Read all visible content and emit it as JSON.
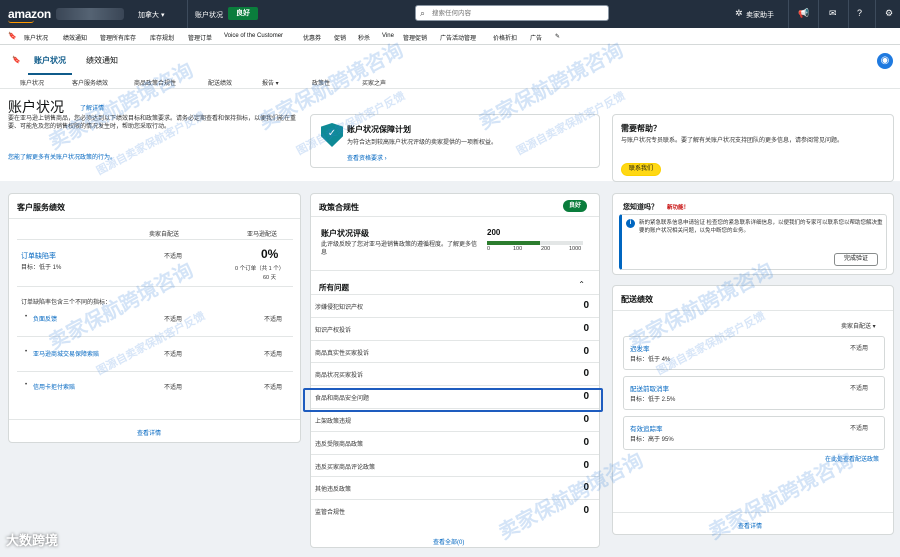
{
  "topbar": {
    "logo": "amazon",
    "region": "加拿大 ▾",
    "account_label": "账户状况",
    "account_badge": "良好",
    "search_placeholder": "搜索任何内容",
    "assistant": "卖家助手"
  },
  "nav": {
    "items": [
      "账户状况",
      "绩效通知",
      "管理所有库存",
      "库存规划",
      "管理订单",
      "Voice of the Customer",
      "优惠券",
      "促销",
      "秒杀",
      "Vine",
      "管理促销",
      "广告活动管理",
      "价格折扣",
      "广告"
    ]
  },
  "tabs": {
    "items": [
      "账户状况",
      "绩效通知"
    ]
  },
  "subnav": {
    "items": [
      "账户状况",
      "客户服务绩效",
      "商品政策合规性",
      "配送绩效",
      "报告 ▾",
      "政策性",
      "买家之声"
    ]
  },
  "header": {
    "title": "账户状况",
    "learn_more": "了解详情",
    "description": "要在亚马逊上销售商品，您必须达到以下绩效目标和政策要求。请务必定期查看和保持指标，以便我们能在重要、可能危及您的销售权限的情况发生时，帮助您采取行动。",
    "footer_link": "您能了解更多有关账户状况政策的行为。"
  },
  "protection": {
    "title": "账户状况保障计划",
    "description": "为符合达到较高账户状况评级的卖家提供的一项新权益。",
    "link": "查看资格要求 ›"
  },
  "help": {
    "title": "需要帮助？",
    "description": "与账户状况专员联系。要了解有关账户状况支持团队的更多信息，请参阅常见问题。",
    "button": "联系我们"
  },
  "customer_service": {
    "title": "客户服务绩效",
    "col_seller": "卖家自配送",
    "col_amazon": "亚马逊配送",
    "odr_label": "订单缺陷率",
    "odr_target": "目标：低于 1%",
    "odr_seller": "不适用",
    "odr_amazon": "0%",
    "odr_orders": "0 个订单（共 1 个）",
    "odr_days": "60 天",
    "metrics_intro": "订单缺陷率包含三个不同的指标：",
    "metrics": [
      {
        "label": "负面反馈",
        "seller": "不适用",
        "amazon": "不适用"
      },
      {
        "label": "亚马逊商城交易保障索赔",
        "seller": "不适用",
        "amazon": "不适用"
      },
      {
        "label": "信用卡拒付索赔",
        "seller": "不适用",
        "amazon": "不适用"
      }
    ],
    "view_details": "查看详情"
  },
  "policy": {
    "title": "政策合规性",
    "badge": "良好",
    "rating_title": "账户状况评级",
    "rating_desc": "此评级反映了您对亚马逊销售政策的遵循程度。了解更多信息",
    "score": "200",
    "score_value": 200,
    "score_max": 1000,
    "ticks": [
      "0",
      "100",
      "200",
      "1000"
    ],
    "issues_title": "所有问题",
    "issues": [
      {
        "label": "涉嫌侵犯知识产权",
        "count": "0"
      },
      {
        "label": "知识产权投诉",
        "count": "0"
      },
      {
        "label": "商品真实性买家投诉",
        "count": "0"
      },
      {
        "label": "商品状况买家投诉",
        "count": "0"
      },
      {
        "label": "食品和商品安全问题",
        "count": "0"
      },
      {
        "label": "上架政策违规",
        "count": "0"
      },
      {
        "label": "违反受限商品政策",
        "count": "0"
      },
      {
        "label": "违反买家商品评论政策",
        "count": "0"
      },
      {
        "label": "其他违反政策",
        "count": "0"
      },
      {
        "label": "监管合规性",
        "count": "0"
      }
    ],
    "view_all": "查看全部(0)"
  },
  "notice": {
    "title": "您知道吗？",
    "new_tag": "新功能！",
    "text": "新的紧急联系信息申请验证 检查您的紧急联系详细信息，以便我们的专家可以联系您以帮助您解决重要的账户状况相关问题，以免中断您的业务。",
    "button": "完成验证"
  },
  "shipping": {
    "title": "配送绩效",
    "filter": "卖家自配送 ▾",
    "metrics": [
      {
        "label": "迟发率",
        "target": "目标：低于 4%",
        "value": "不适用"
      },
      {
        "label": "配送前取消率",
        "target": "目标：低于 2.5%",
        "value": "不适用"
      },
      {
        "label": "有效追踪率",
        "target": "目标：高于 95%",
        "value": "不适用"
      }
    ],
    "link": "在此处查看配送政策",
    "view_details": "查看详情"
  },
  "watermarks": {
    "main": "卖家保航跨境咨询",
    "sub": "图源自卖家保航客户反馈",
    "corner": "大数跨境"
  }
}
